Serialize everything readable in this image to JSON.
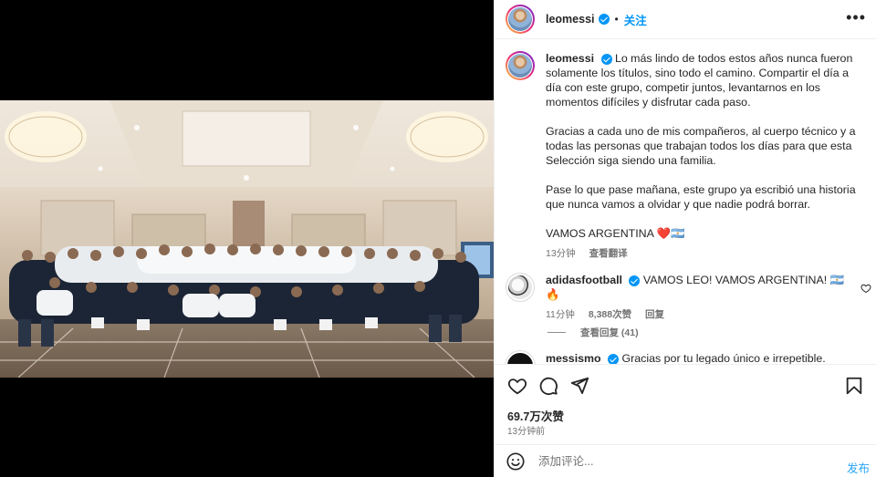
{
  "post": {
    "author": "leomessi",
    "follow_label": "关注",
    "separator": "•",
    "more_label": "•••"
  },
  "caption": {
    "username": "leomessi",
    "paragraphs": [
      "Lo más lindo de todos estos años nunca fueron solamente los títulos, sino todo el camino. Compartir el día a día con este grupo, competir juntos, levantarnos en los momentos difíciles y disfrutar cada paso.",
      "Gracias a cada uno de mis compañeros, al cuerpo técnico y a todas las personas que trabajan todos los días para que esta Selección siga siendo una familia.",
      "Pase lo que pase mañana, este grupo ya escribió una historia que nunca vamos a olvidar y que nadie podrá borrar.",
      "VAMOS ARGENTINA ❤️🇦🇷"
    ],
    "time": "13分钟",
    "translate_label": "查看翻译"
  },
  "comments": [
    {
      "username": "adidasfootball",
      "text": "VAMOS LEO! VAMOS ARGENTINA! 🇦🇷 🔥",
      "time": "11分钟",
      "likes": "8,388次赞",
      "reply_label": "回复",
      "view_replies": "查看回复 (41)"
    },
    {
      "username": "messismo",
      "text": "Gracias por tu legado único e irrepetible."
    }
  ],
  "actions": {
    "likes_count": "69.7万次赞",
    "posted_ago": "13分钟前"
  },
  "comment_box": {
    "placeholder": "添加评论...",
    "post_label": "发布"
  },
  "colors": {
    "accent": "#0095f6",
    "text": "#262626",
    "muted": "#737373"
  }
}
